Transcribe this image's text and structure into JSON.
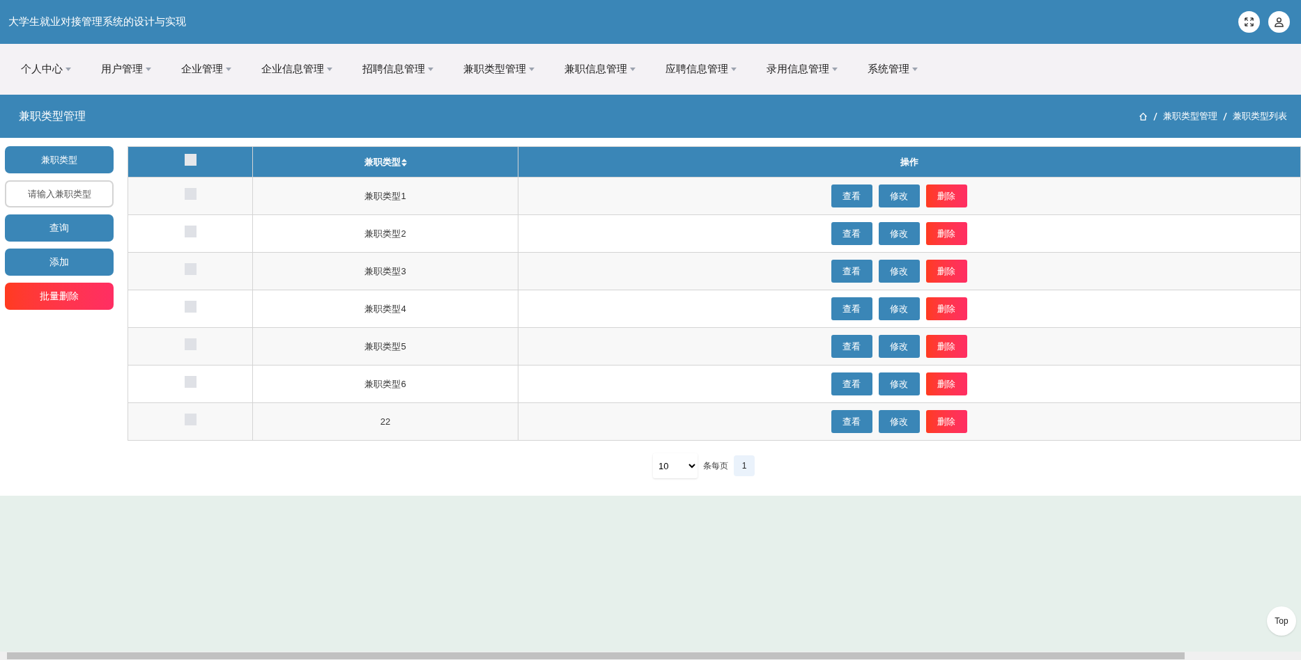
{
  "header": {
    "title": "大学生就业对接管理系统的设计与实现"
  },
  "nav": [
    {
      "label": "个人中心"
    },
    {
      "label": "用户管理"
    },
    {
      "label": "企业管理"
    },
    {
      "label": "企业信息管理"
    },
    {
      "label": "招聘信息管理"
    },
    {
      "label": "兼职类型管理"
    },
    {
      "label": "兼职信息管理"
    },
    {
      "label": "应聘信息管理"
    },
    {
      "label": "录用信息管理"
    },
    {
      "label": "系统管理"
    }
  ],
  "page_bar": {
    "title": "兼职类型管理",
    "breadcrumb": [
      "兼职类型管理",
      "兼职类型列表"
    ]
  },
  "sidebar": {
    "label": "兼职类型",
    "search": {
      "placeholder": "请输入兼职类型"
    },
    "buttons": [
      {
        "label": "查询",
        "kind": "primary"
      },
      {
        "label": "添加",
        "kind": "primary"
      },
      {
        "label": "批量删除",
        "kind": "danger"
      }
    ]
  },
  "table": {
    "select_all": {
      "checked": false
    },
    "columns": [
      "兼职类型",
      "操作"
    ],
    "rows": [
      {
        "checked": false,
        "type": "兼职类型1",
        "actions": [
          "查看",
          "修改",
          "删除"
        ]
      },
      {
        "checked": false,
        "type": "兼职类型2",
        "actions": [
          "查看",
          "修改",
          "删除"
        ]
      },
      {
        "checked": false,
        "type": "兼职类型3",
        "actions": [
          "查看",
          "修改",
          "删除"
        ]
      },
      {
        "checked": false,
        "type": "兼职类型4",
        "actions": [
          "查看",
          "修改",
          "删除"
        ]
      },
      {
        "checked": false,
        "type": "兼职类型5",
        "actions": [
          "查看",
          "修改",
          "删除"
        ]
      },
      {
        "checked": false,
        "type": "兼职类型6",
        "actions": [
          "查看",
          "修改",
          "删除"
        ]
      },
      {
        "checked": false,
        "type": "22",
        "actions": [
          "查看",
          "修改",
          "删除"
        ]
      }
    ]
  },
  "pagination": {
    "page_size": "10",
    "per_page_label": "条每页",
    "pages": [
      {
        "label": "1",
        "selected": true
      }
    ]
  },
  "back_to_top": "Top"
}
